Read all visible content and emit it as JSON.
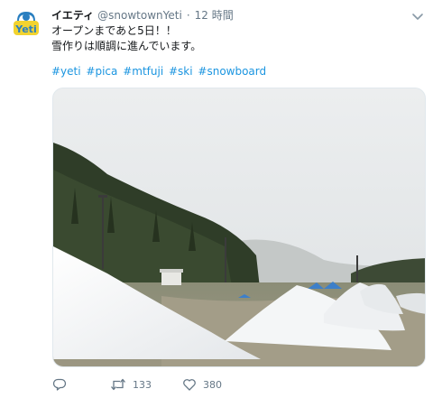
{
  "user": {
    "display_name": "イエティ",
    "handle": "@snowtownYeti",
    "separator": "·",
    "time": "12 時間",
    "avatar_text": "Yeti"
  },
  "tweet": {
    "lines": [
      "オープンまであと5日！！",
      "雪作りは順調に進んでいます。"
    ],
    "hashtags": [
      "#yeti",
      "#pica",
      "#mtfuji",
      "#ski",
      "#snowboard"
    ]
  },
  "actions": {
    "retweet_count": "133",
    "like_count": "380"
  },
  "colors": {
    "link": "#1b95e0",
    "secondary_text": "#657786",
    "avatar_yellow": "#f2d330",
    "avatar_blue": "#2a7fc0"
  },
  "icons": {
    "caret": "chevron-down-icon",
    "reply": "reply-icon",
    "retweet": "retweet-icon",
    "like": "heart-icon"
  }
}
